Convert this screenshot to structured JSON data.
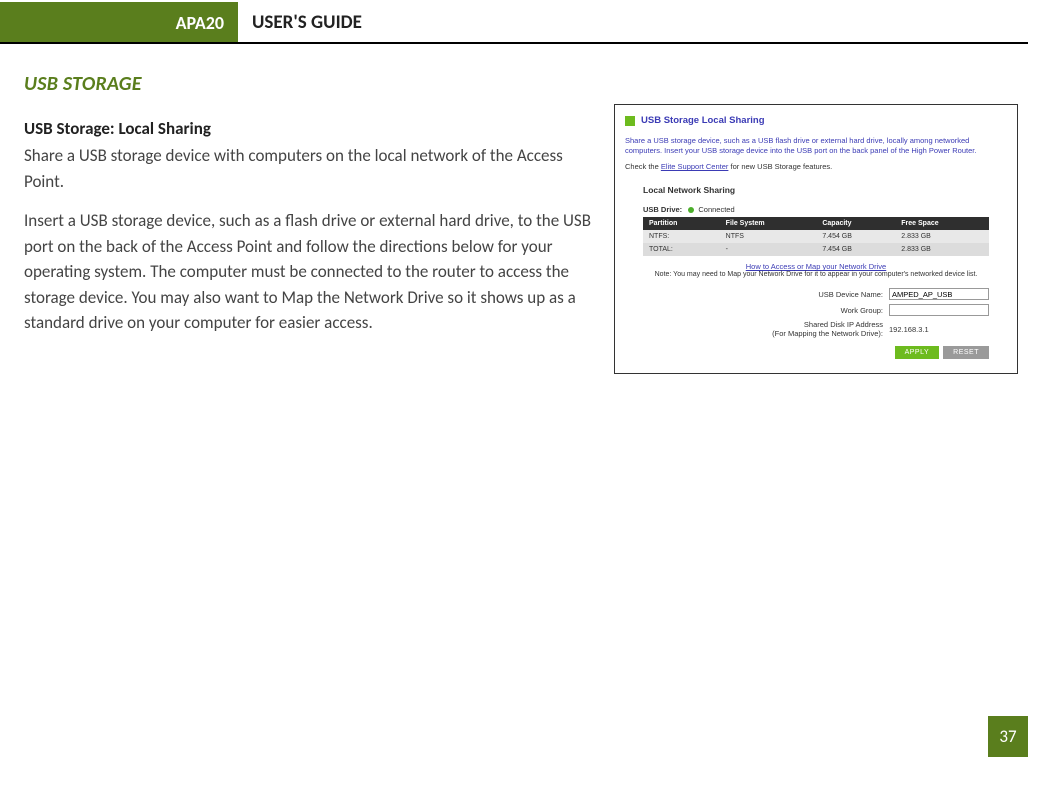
{
  "header": {
    "model": "APA20",
    "title": "USER'S GUIDE"
  },
  "section": {
    "title": "USB STORAGE",
    "subtitle": "USB Storage: Local Sharing",
    "para1": "Share a USB storage device with computers on the local network of the Access Point.",
    "para2": "Insert a USB storage device, such as a flash drive or external hard drive, to the USB port on the back of the Access Point and follow the directions below for your operating system. The computer must be connected to the router to access the storage device. You may also want to Map the Network Drive so it shows up as a standard drive on your computer for easier access."
  },
  "panel": {
    "title": "USB Storage Local Sharing",
    "desc": "Share a USB storage device, such as a USB flash drive or external hard drive, locally among networked computers. Insert your USB storage device into the USB port on the back panel of the High Power Router.",
    "check_prefix": "Check the ",
    "check_link": "Elite Support Center",
    "check_suffix": " for new USB Storage features.",
    "lns_heading": "Local Network Sharing",
    "usb_label": "USB Drive:",
    "usb_status": "Connected",
    "table": {
      "headers": [
        "Partition",
        "File System",
        "Capacity",
        "Free Space"
      ],
      "rows": [
        [
          "NTFS:",
          "NTFS",
          "7.454 GB",
          "2.833 GB"
        ],
        [
          "TOTAL:",
          "-",
          "7.454 GB",
          "2.833 GB"
        ]
      ]
    },
    "howto_link": "How to Access or Map your Network Drive",
    "note_prefix": "Note: You may need to ",
    "note_link": "Map your Network Drive",
    "note_suffix": " for it to appear in your computer's networked device list.",
    "form": {
      "device_label": "USB Device Name:",
      "device_value": "AMPED_AP_USB",
      "workgroup_label": "Work Group:",
      "workgroup_value": "",
      "ip_label_line1": "Shared Disk IP Address",
      "ip_label_line2": "(For Mapping the Network Drive):",
      "ip_value": "192.168.3.1"
    },
    "buttons": {
      "apply": "APPLY",
      "reset": "RESET"
    }
  },
  "page_number": "37"
}
